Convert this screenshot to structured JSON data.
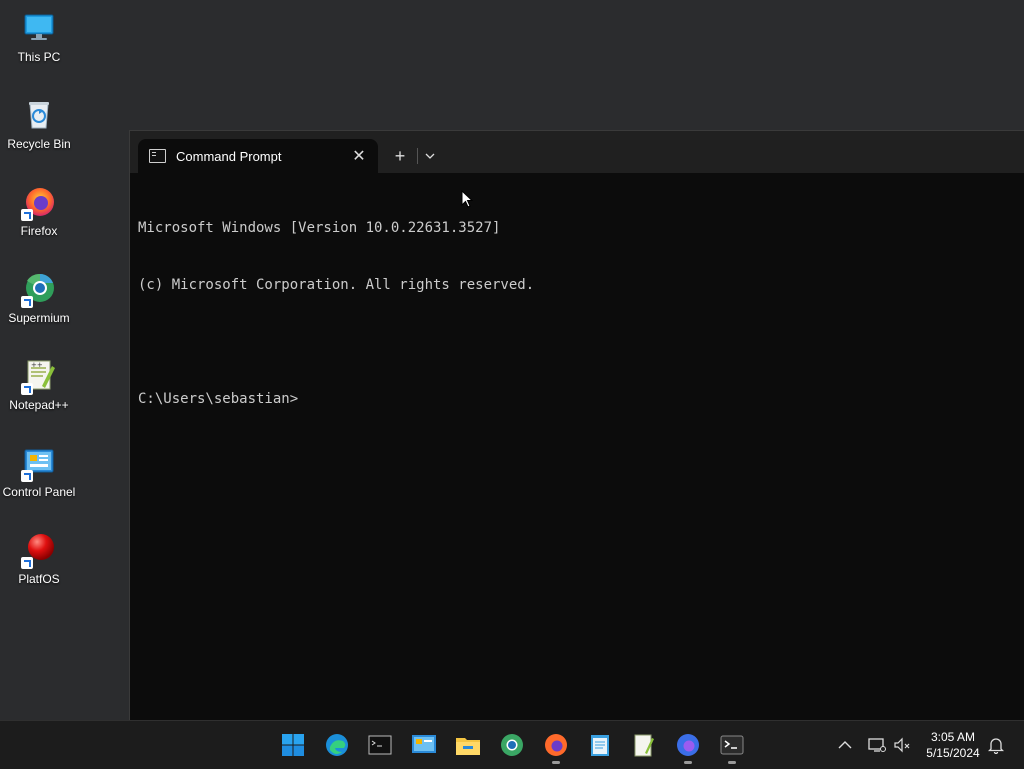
{
  "desktop": {
    "icons": [
      {
        "label": "This PC",
        "icon": "monitor-icon"
      },
      {
        "label": "Recycle Bin",
        "icon": "recycle-bin-icon"
      },
      {
        "label": "Firefox",
        "icon": "firefox-icon"
      },
      {
        "label": "Supermium",
        "icon": "supermium-icon"
      },
      {
        "label": "Notepad++",
        "icon": "notepad-plus-plus-icon"
      },
      {
        "label": "Control Panel",
        "icon": "control-panel-icon"
      },
      {
        "label": "PlatfOS",
        "icon": "platfos-icon"
      }
    ]
  },
  "terminal": {
    "tab_title": "Command Prompt",
    "close_glyph": "✕",
    "new_tab_glyph": "+",
    "lines": [
      "Microsoft Windows [Version 10.0.22631.3527]",
      "(c) Microsoft Corporation. All rights reserved.",
      "",
      "C:\\Users\\sebastian>"
    ]
  },
  "taskbar": {
    "apps": [
      "start-icon",
      "edge-icon",
      "command-prompt-icon",
      "control-panel-icon",
      "file-explorer-icon",
      "supermium-icon",
      "firefox-icon",
      "notepad-icon",
      "notepad-plus-plus-icon",
      "firefox-dev-icon",
      "terminal-icon"
    ],
    "time": "3:05 AM",
    "date": "5/15/2024"
  },
  "colors": {
    "desktop_bg": "#2b2c2e",
    "terminal_bg": "#0c0c0c",
    "titlebar_bg": "#202020",
    "taskbar_bg": "#1c1c1c",
    "console_text": "#cccccc"
  }
}
